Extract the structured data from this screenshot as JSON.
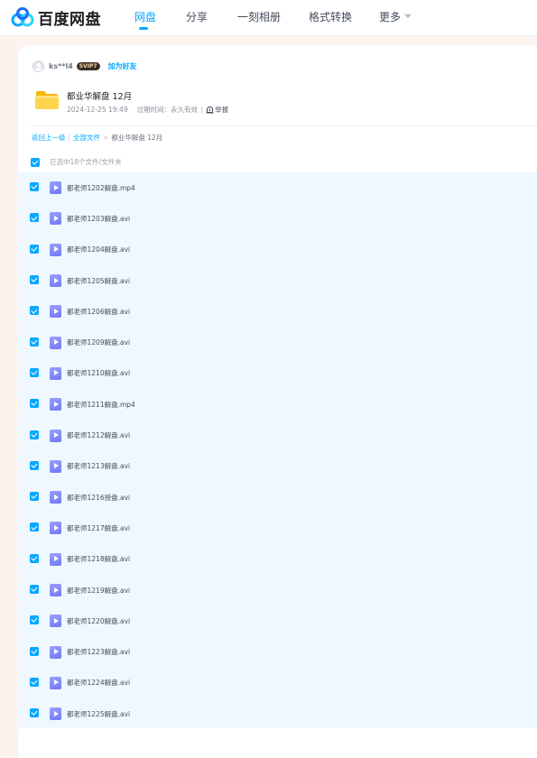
{
  "app": {
    "brand": "百度网盘",
    "nav": [
      {
        "label": "网盘",
        "active": true
      },
      {
        "label": "分享",
        "active": false
      },
      {
        "label": "一刻相册",
        "active": false
      },
      {
        "label": "格式转换",
        "active": false
      },
      {
        "label": "更多",
        "active": false
      }
    ]
  },
  "share": {
    "owner": "ks**l4",
    "vip_badge": "SVIP7",
    "add_friend": "加为好友",
    "folder_name": "都业华解盘 12月",
    "date": "2024-12-25 19:49",
    "expiry_label": "过期时间：",
    "expiry_value": "永久有效",
    "report": "举报"
  },
  "breadcrumb": {
    "back": "返回上一级",
    "all_files": "全部文件",
    "current": "都业华解盘 12月"
  },
  "selection": {
    "summary": "已选中18个文件/文件夹"
  },
  "files": [
    "都老师1202解盘.mp4",
    "都老师1203解盘.avi",
    "都老师1204解盘.avi",
    "都老师1205解盘.avi",
    "都老师1206解盘.avi",
    "都老师1209解盘.avi",
    "都老师1210解盘.avi",
    "都老师1211解盘.mp4",
    "都老师1212解盘.avi",
    "都老师1213解盘.avi",
    "都老师1216授盘.avi",
    "都老师1217解盘.avi",
    "都老师1218解盘.avi",
    "都老师1219解盘.avi",
    "都老师1220解盘.avi",
    "都老师1223解盘.avi",
    "都老师1224解盘.avi",
    "都老师1225解盘.avi"
  ],
  "colors": {
    "accent": "#06a7ff",
    "list_bg": "#f0f8ff",
    "page_bg": "#fdf3ee"
  }
}
